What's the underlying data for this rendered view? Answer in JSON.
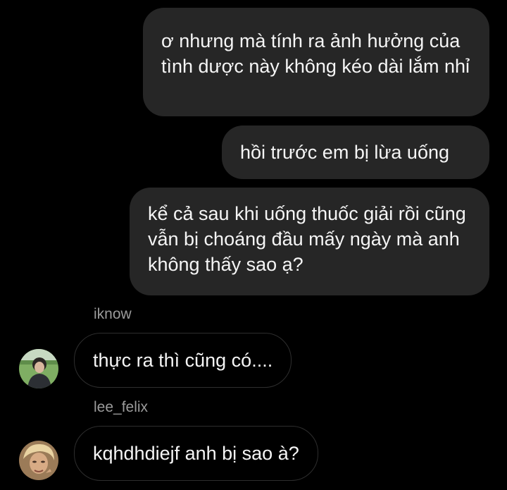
{
  "conversation": {
    "messages": [
      {
        "from": "me",
        "text": "ơ nhưng mà tính ra ảnh hưởng của tình dược này không kéo dài lắm nhỉ"
      },
      {
        "from": "me",
        "text": "hồi trước em bị lừa uống"
      },
      {
        "from": "me",
        "text": "kể cả sau khi uống thuốc giải rồi cũng vẫn bị choáng đầu mấy ngày mà anh không thấy sao ạ?"
      },
      {
        "from": "iknow",
        "sender_label": "iknow",
        "text": "thực ra thì cũng có...."
      },
      {
        "from": "lee_felix",
        "sender_label": "lee_felix",
        "text": "kqhdhdiejf anh bị sao à?"
      }
    ]
  },
  "avatars": {
    "iknow": {
      "icon": "profile-photo-icon"
    },
    "lee_felix": {
      "icon": "profile-photo-icon"
    }
  },
  "colors": {
    "background": "#000000",
    "sent_bubble": "#262626",
    "received_border": "#2e2e2e",
    "text": "#f5f5f5",
    "sender_label": "#9b9b9b"
  }
}
